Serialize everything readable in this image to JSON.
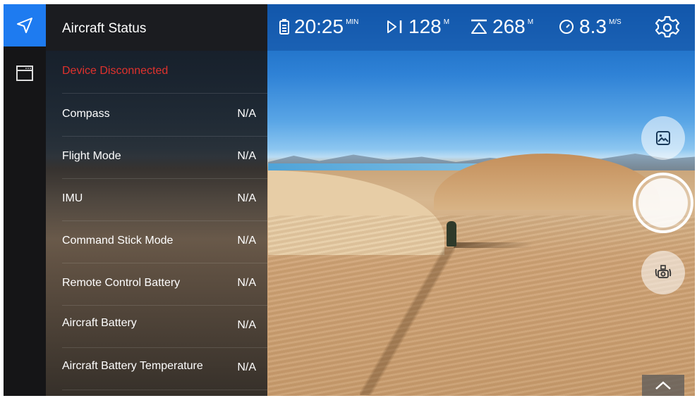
{
  "panel": {
    "title": "Aircraft Status",
    "alert": "Device Disconnected",
    "rows": [
      {
        "label": "Compass",
        "value": "N/A"
      },
      {
        "label": "Flight Mode",
        "value": "N/A"
      },
      {
        "label": "IMU",
        "value": "N/A"
      },
      {
        "label": "Command Stick Mode",
        "value": "N/A"
      },
      {
        "label": "Remote Control Battery",
        "value": "N/A"
      },
      {
        "label": "Aircraft Battery",
        "value": "N/A"
      },
      {
        "label": "Aircraft Battery Temperature",
        "value": "N/A"
      }
    ]
  },
  "telemetry": {
    "flight_time": {
      "value": "20:25",
      "unit": "MIN",
      "icon": "battery-clipboard-icon"
    },
    "distance": {
      "value": "128",
      "unit": "M",
      "icon": "distance-icon"
    },
    "altitude": {
      "value": "268",
      "unit": "M",
      "icon": "altitude-icon"
    },
    "speed": {
      "value": "8.3",
      "unit": "M/S",
      "icon": "speedometer-icon"
    }
  },
  "colors": {
    "accent": "#1e7bf0",
    "alert": "#e0322d"
  }
}
